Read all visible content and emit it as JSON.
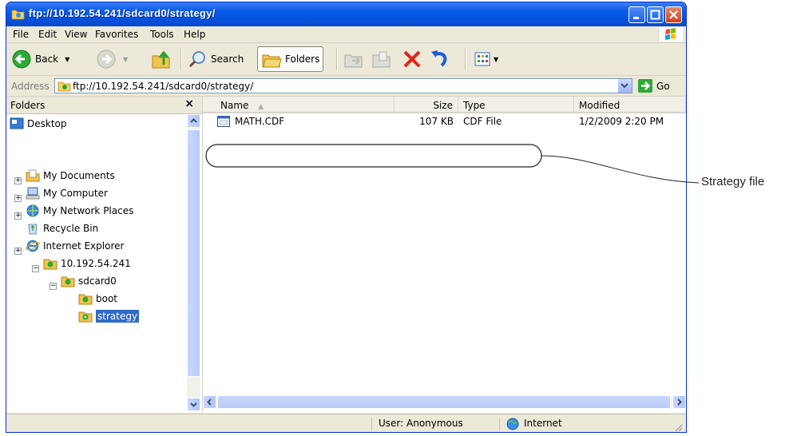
{
  "window": {
    "title": "ftp://10.192.54.241/sdcard0/strategy/"
  },
  "menu": [
    "File",
    "Edit",
    "View",
    "Favorites",
    "Tools",
    "Help"
  ],
  "toolbar": {
    "back_label": "Back",
    "search_label": "Search",
    "folders_label": "Folders"
  },
  "address": {
    "label": "Address",
    "value": "ftp://10.192.54.241/sdcard0/strategy/",
    "go_label": "Go"
  },
  "folders_pane": {
    "title": "Folders",
    "close": "×",
    "items": [
      {
        "label": "Desktop"
      },
      {
        "label": "My Documents"
      },
      {
        "label": "My Computer"
      },
      {
        "label": "My Network Places"
      },
      {
        "label": "Recycle Bin"
      },
      {
        "label": "Internet Explorer"
      },
      {
        "label": "10.192.54.241"
      },
      {
        "label": "sdcard0"
      },
      {
        "label": "boot"
      },
      {
        "label": "strategy"
      }
    ]
  },
  "file_list": {
    "columns": [
      "Name",
      "Size",
      "Type",
      "Modified"
    ],
    "rows": [
      {
        "name": "MATH.CDF",
        "size": "107 KB",
        "type": "CDF File",
        "modified": "1/2/2009 2:20 PM"
      }
    ]
  },
  "status": {
    "user": "User: Anonymous",
    "zone": "Internet"
  },
  "callout": {
    "label": "Strategy file"
  },
  "colors": {
    "title_blue": "#0a5ce8",
    "selection": "#316ac5",
    "close_red": "#cf3f1c"
  }
}
